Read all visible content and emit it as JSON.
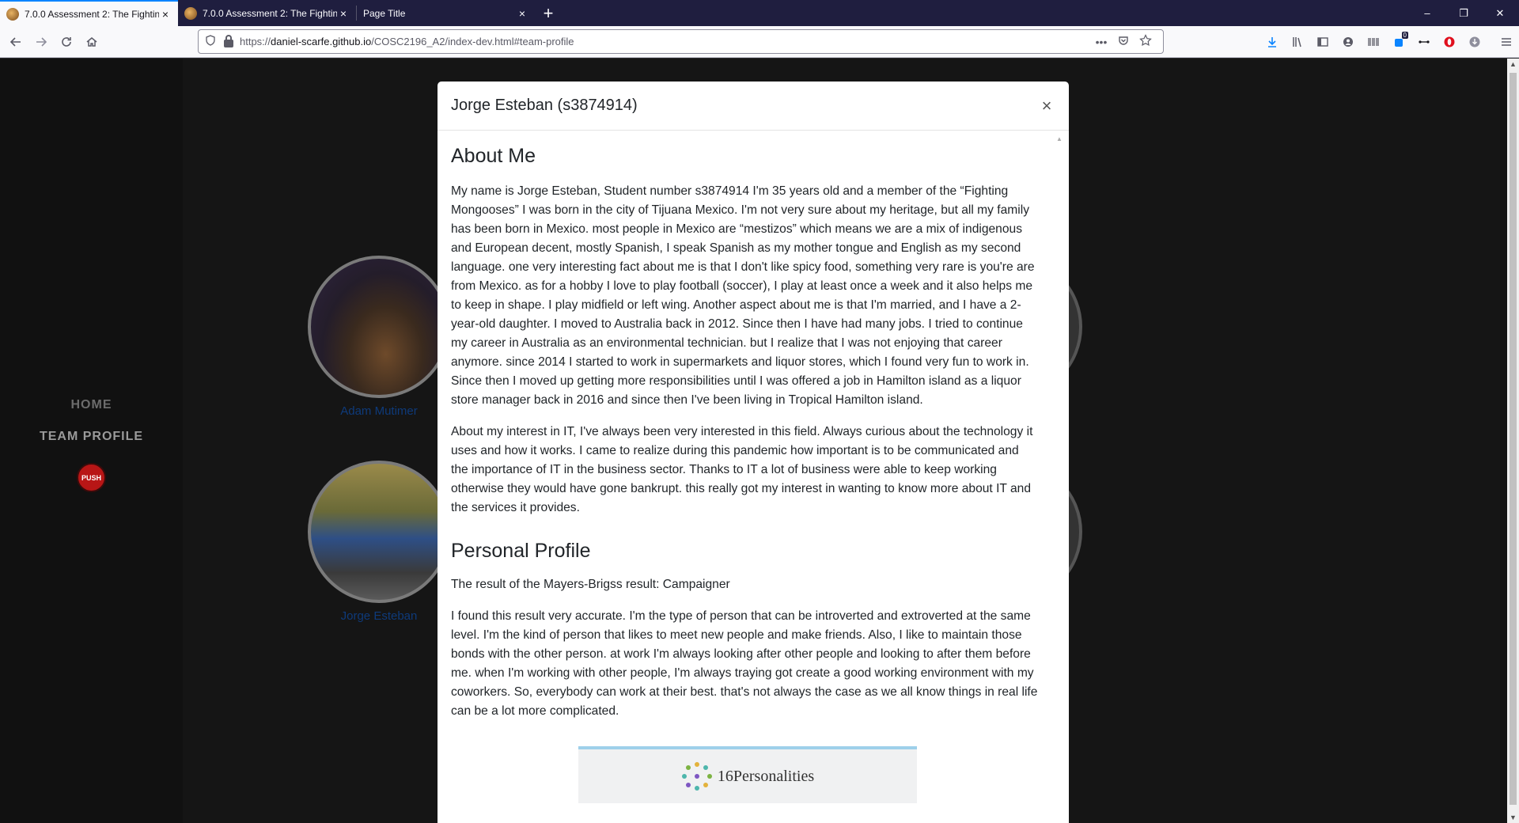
{
  "browser": {
    "tabs": [
      {
        "title": "7.0.0 Assessment 2: The Fightin",
        "active": true
      },
      {
        "title": "7.0.0 Assessment 2: The Fightin",
        "active": false
      },
      {
        "title": "Page Title",
        "active": false
      }
    ],
    "tab_close": "×",
    "new_tab": "+",
    "window_controls": {
      "minimize": "–",
      "restore": "❐",
      "close": "✕"
    },
    "url_prefix": "https://",
    "url_domain": "daniel-scarfe.github.io",
    "url_path": "/COSC2196_A2/index-dev.html#team-profile",
    "page_actions_label": "•••",
    "extension_badge": "0"
  },
  "sidebar": {
    "home_label": "HOME",
    "team_profile_label": "TEAM PROFILE",
    "push_label": "PUSH"
  },
  "members": [
    {
      "name": "Adam Mutimer"
    },
    {
      "name": "Jorge Esteban"
    }
  ],
  "modal": {
    "title": "Jorge Esteban (s3874914)",
    "close_label": "×",
    "about_heading": "About Me",
    "about_p1": "My name is Jorge Esteban, Student number s3874914 I'm 35 years old and a member of the “Fighting Mongooses” I was born in the city of Tijuana Mexico. I'm not very sure about my heritage, but all my family has been born in Mexico. most people in Mexico are “mestizos” which means we are a mix of indigenous and European decent, mostly Spanish, I speak Spanish as my mother tongue and English as my second language. one very interesting fact about me is that I don't like spicy food, something very rare is you're are from Mexico. as for a hobby I love to play football (soccer), I play at least once a week and it also helps me to keep in shape. I play midfield or left wing. Another aspect about me is that I'm married, and I have a 2-year-old daughter. I moved to Australia back in 2012. Since then I have had many jobs. I tried to continue my career in Australia as an environmental technician. but I realize that I was not enjoying that career anymore. since 2014 I started to work in supermarkets and liquor stores, which I found very fun to work in. Since then I moved up getting more responsibilities until I was offered a job in Hamilton island as a liquor store manager back in 2016 and since then I've been living in Tropical Hamilton island.",
    "about_p2": "About my interest in IT, I've always been very interested in this field. Always curious about the technology it uses and how it works. I came to realize during this pandemic how important is to be communicated and the importance of IT in the business sector. Thanks to IT a lot of business were able to keep working otherwise they would have gone bankrupt. this really got my interest in wanting to know more about IT and the services it provides.",
    "profile_heading": "Personal Profile",
    "profile_p1": "The result of the Mayers-Brigss result: Campaigner",
    "profile_p2": "I found this result very accurate. I'm the type of person that can be introverted and extroverted at the same level. I'm the kind of person that likes to meet new people and make friends. Also, I like to maintain those bonds with the other person. at work I'm always looking after other people and looking to after them before me. when I'm working with other people, I'm always traying got create a good working environment with my coworkers. So, everybody can work at their best. that's not always the case as we all know things in real life can be a lot more complicated.",
    "personalities_logo": "16Personalities"
  }
}
